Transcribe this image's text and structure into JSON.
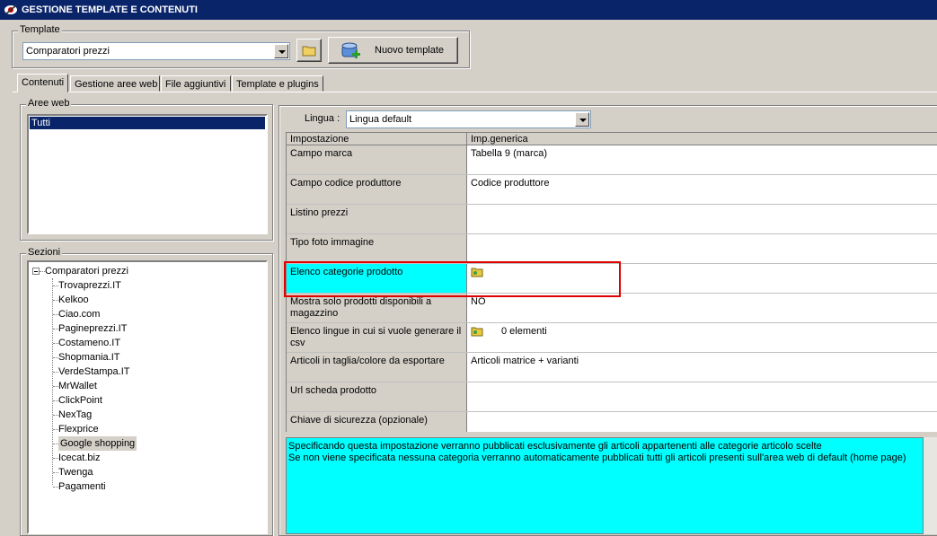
{
  "window": {
    "title": "GESTIONE TEMPLATE E CONTENUTI"
  },
  "template": {
    "group_label": "Template",
    "selected": "Comparatori prezzi",
    "new_button": "Nuovo template"
  },
  "tabs": [
    {
      "label": "Contenuti",
      "active": true
    },
    {
      "label": "Gestione aree web"
    },
    {
      "label": "File aggiuntivi"
    },
    {
      "label": "Template e plugins"
    }
  ],
  "aree_web": {
    "label": "Aree web",
    "items": [
      "Tutti"
    ]
  },
  "sezioni": {
    "label": "Sezioni",
    "root": "Comparatori prezzi",
    "children": [
      "Trovaprezzi.IT",
      "Kelkoo",
      "Ciao.com",
      "Pagineprezzi.IT",
      "Costameno.IT",
      "Shopmania.IT",
      "VerdeStampa.IT",
      "MrWallet",
      "ClickPoint",
      "NexTag",
      "Flexprice",
      "Google shopping",
      "Icecat.biz",
      "Twenga",
      "Pagamenti"
    ],
    "selected": "Google shopping"
  },
  "lingua": {
    "label": "Lingua :",
    "value": "Lingua default"
  },
  "grid": {
    "headers": [
      "Impostazione",
      "Imp.generica"
    ],
    "rows": [
      {
        "setting": "Campo marca",
        "value": "Tabella 9 (marca)"
      },
      {
        "setting": "Campo codice produttore",
        "value": "Codice produttore"
      },
      {
        "setting": "Listino prezzi",
        "value": ""
      },
      {
        "setting": "Tipo foto immagine",
        "value": ""
      },
      {
        "setting": "Elenco categorie prodotto",
        "value": "",
        "icon": true,
        "highlight": true
      },
      {
        "setting": "Mostra solo prodotti disponibili a magazzino",
        "value": "NO"
      },
      {
        "setting": "Elenco lingue in cui si vuole generare il csv",
        "value": "0 elementi",
        "icon": true
      },
      {
        "setting": "Articoli in taglia/colore da esportare",
        "value": "Articoli matrice + varianti"
      },
      {
        "setting": "Url scheda prodotto",
        "value": ""
      },
      {
        "setting": "Chiave di sicurezza (opzionale)",
        "value": ""
      }
    ]
  },
  "description": {
    "line1": "Specificando questa impostazione verranno pubblicati esclusivamente gli articoli appartenenti alle categorie articolo scelte",
    "line2": "Se non viene specificata nessuna categoria verranno automaticamente pubblicati tutti gli articoli presenti sull'area web di default (home page)"
  },
  "colors": {
    "titlebar": "#0a246a",
    "highlight": "#00ffff",
    "annotation": "#e00000"
  }
}
